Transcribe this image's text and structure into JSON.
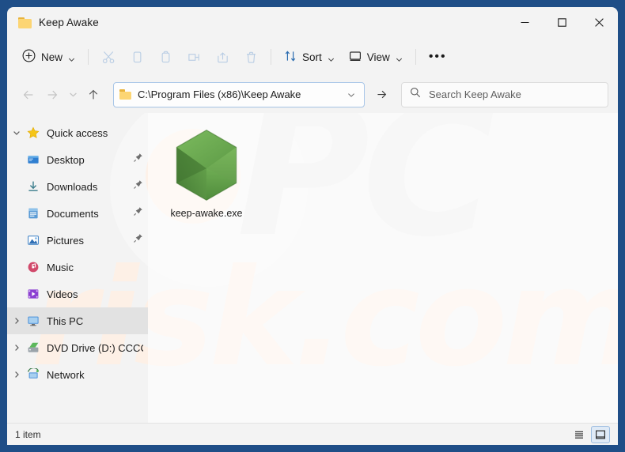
{
  "window": {
    "title": "Keep Awake",
    "title_icon": "folder-icon",
    "controls": {
      "minimize": "minimize-icon",
      "maximize": "maximize-icon",
      "close": "close-icon"
    }
  },
  "toolbar": {
    "new_label": "New",
    "new_icon": "plus-circle-icon",
    "actions": [
      {
        "name": "cut",
        "icon": "scissors-icon",
        "disabled": true
      },
      {
        "name": "copy",
        "icon": "copy-icon",
        "disabled": true
      },
      {
        "name": "paste",
        "icon": "clipboard-icon",
        "disabled": true
      },
      {
        "name": "rename",
        "icon": "rename-icon",
        "disabled": true
      },
      {
        "name": "share",
        "icon": "share-icon",
        "disabled": true
      },
      {
        "name": "delete",
        "icon": "trash-icon",
        "disabled": true
      }
    ],
    "sort_label": "Sort",
    "sort_icon": "sort-arrows-icon",
    "view_label": "View",
    "view_icon": "monitor-icon",
    "more_label": "•••"
  },
  "navigation": {
    "back_icon": "arrow-left-icon",
    "forward_icon": "arrow-right-icon",
    "recent_icon": "chevron-down-icon",
    "up_icon": "arrow-up-icon",
    "address": {
      "path": "C:\\Program Files (x86)\\Keep Awake",
      "folder_icon": "folder-icon",
      "dropdown_icon": "chevron-down-icon"
    },
    "go_icon": "arrow-right-icon",
    "search": {
      "placeholder": "Search Keep Awake",
      "icon": "search-icon"
    }
  },
  "sidebar": {
    "items": [
      {
        "label": "Quick access",
        "icon": "star-icon",
        "expander": "chevron-down",
        "indent": false,
        "pinned": false,
        "selected": false
      },
      {
        "label": "Desktop",
        "icon": "desktop-icon",
        "expander": "",
        "indent": true,
        "pinned": true,
        "selected": false
      },
      {
        "label": "Downloads",
        "icon": "download-icon",
        "expander": "",
        "indent": true,
        "pinned": true,
        "selected": false
      },
      {
        "label": "Documents",
        "icon": "document-icon",
        "expander": "",
        "indent": true,
        "pinned": true,
        "selected": false
      },
      {
        "label": "Pictures",
        "icon": "pictures-icon",
        "expander": "",
        "indent": true,
        "pinned": true,
        "selected": false
      },
      {
        "label": "Music",
        "icon": "music-icon",
        "expander": "",
        "indent": true,
        "pinned": false,
        "selected": false
      },
      {
        "label": "Videos",
        "icon": "video-icon",
        "expander": "",
        "indent": true,
        "pinned": false,
        "selected": false
      },
      {
        "label": "This PC",
        "icon": "monitor-icon",
        "expander": "chevron-right",
        "indent": false,
        "pinned": false,
        "selected": true
      },
      {
        "label": "DVD Drive (D:) CCCC",
        "icon": "dvd-drive-icon",
        "expander": "chevron-right",
        "indent": false,
        "pinned": false,
        "selected": false
      },
      {
        "label": "Network",
        "icon": "network-icon",
        "expander": "chevron-right",
        "indent": false,
        "pinned": false,
        "selected": false
      }
    ]
  },
  "files": [
    {
      "name": "keep-awake.exe",
      "icon": "green-hexagon-icon"
    }
  ],
  "statusbar": {
    "item_count": "1 item",
    "details_view_icon": "list-lines-icon",
    "large_icons_view_icon": "large-icon-tile-icon"
  },
  "watermark": {
    "part1": "PC",
    "part2": "risk.com"
  },
  "colors": {
    "desktop": "#1f4e87",
    "window_bg": "#f3f3f3",
    "address_border": "#a8c6e8",
    "selection": "#e2e2e2",
    "hexagon_green": "#6aa84f",
    "folder_yellow": "#fcd573"
  }
}
